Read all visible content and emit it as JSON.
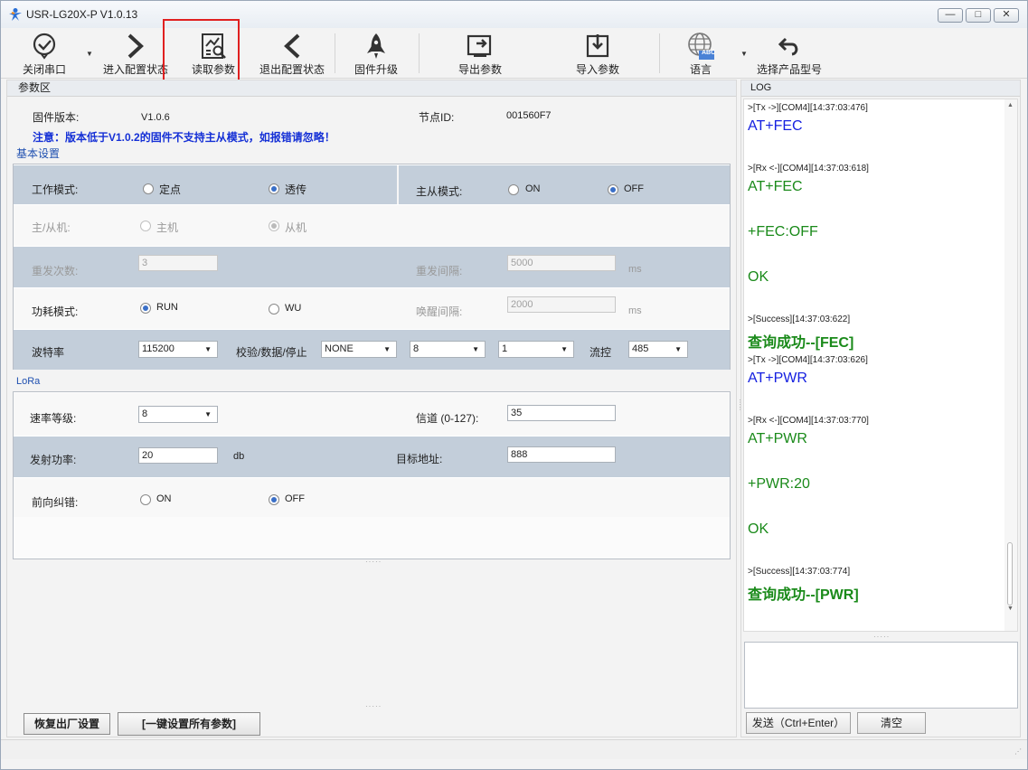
{
  "window": {
    "title": "USR-LG20X-P  V1.0.13",
    "min_symbol": "—",
    "max_symbol": "□",
    "close_symbol": "✕"
  },
  "toolbar": {
    "close_port": "关闭串口",
    "enter_config": "进入配置状态",
    "read_params": "读取参数",
    "exit_config": "退出配置状态",
    "firmware_upgrade": "固件升级",
    "export_params": "导出参数",
    "import_params": "导入参数",
    "language": "语言",
    "language_badge": "ABC",
    "select_model": "选择产品型号"
  },
  "params": {
    "header": "参数区",
    "firmware_label": "固件版本:",
    "firmware_value": "V1.0.6",
    "node_id_label": "节点ID:",
    "node_id_value": "001560F7",
    "note": "注意：版本低于V1.0.2的固件不支持主从模式，如报错请忽略！",
    "basic": {
      "title": "基本设置",
      "work_mode_label": "工作模式:",
      "work_mode_options": [
        "定点",
        "透传"
      ],
      "work_mode_selected": "透传",
      "master_slave_mode_label": "主从模式:",
      "master_slave_options": [
        "ON",
        "OFF"
      ],
      "master_slave_selected": "OFF",
      "role_label": "主/从机:",
      "role_options": [
        "主机",
        "从机"
      ],
      "role_selected": "从机",
      "retry_count_label": "重发次数:",
      "retry_count_value": "3",
      "retry_interval_label": "重发间隔:",
      "retry_interval_value": "5000",
      "retry_interval_unit": "ms",
      "power_mode_label": "功耗模式:",
      "power_mode_options": [
        "RUN",
        "WU"
      ],
      "power_mode_selected": "RUN",
      "wake_interval_label": "唤醒间隔:",
      "wake_interval_value": "2000",
      "wake_interval_unit": "ms",
      "baud_label": "波特率",
      "baud_value": "115200",
      "parity_label": "校验/数据/停止",
      "parity_value": "NONE",
      "data_bits_value": "8",
      "stop_bits_value": "1",
      "flow_label": "流控",
      "flow_value": "485"
    },
    "lora": {
      "title": "LoRa",
      "rate_label": "速率等级:",
      "rate_value": "8",
      "channel_label": "信道 (0-127):",
      "channel_value": "35",
      "tx_power_label": "发射功率:",
      "tx_power_value": "20",
      "tx_power_unit": "db",
      "target_addr_label": "目标地址:",
      "target_addr_value": "888",
      "fec_label": "前向纠错:",
      "fec_options": [
        "ON",
        "OFF"
      ],
      "fec_selected": "OFF"
    },
    "restore_button": "恢复出厂设置",
    "set_all_button": "[一键设置所有参数]"
  },
  "log": {
    "header": "LOG",
    "entries": [
      {
        "meta": ">[Tx ->][COM4][14:37:03:476]",
        "text": "AT+FEC"
      },
      {
        "meta": ">[Rx <-][COM4][14:37:03:618]",
        "text": "AT+FEC",
        "reply": "+FEC:OFF",
        "ok": "OK"
      },
      {
        "meta": ">[Success][14:37:03:622]",
        "text": "查询成功--[FEC]"
      },
      {
        "meta": ">[Tx ->][COM4][14:37:03:626]",
        "text": "AT+PWR"
      },
      {
        "meta": ">[Rx <-][COM4][14:37:03:770]",
        "text": "AT+PWR",
        "reply": "+PWR:20",
        "ok": "OK"
      },
      {
        "meta": ">[Success][14:37:03:774]",
        "text": "查询成功--[PWR]"
      }
    ],
    "send_button": "发送（Ctrl+Enter）",
    "clear_button": "清空",
    "send_input_value": ""
  }
}
